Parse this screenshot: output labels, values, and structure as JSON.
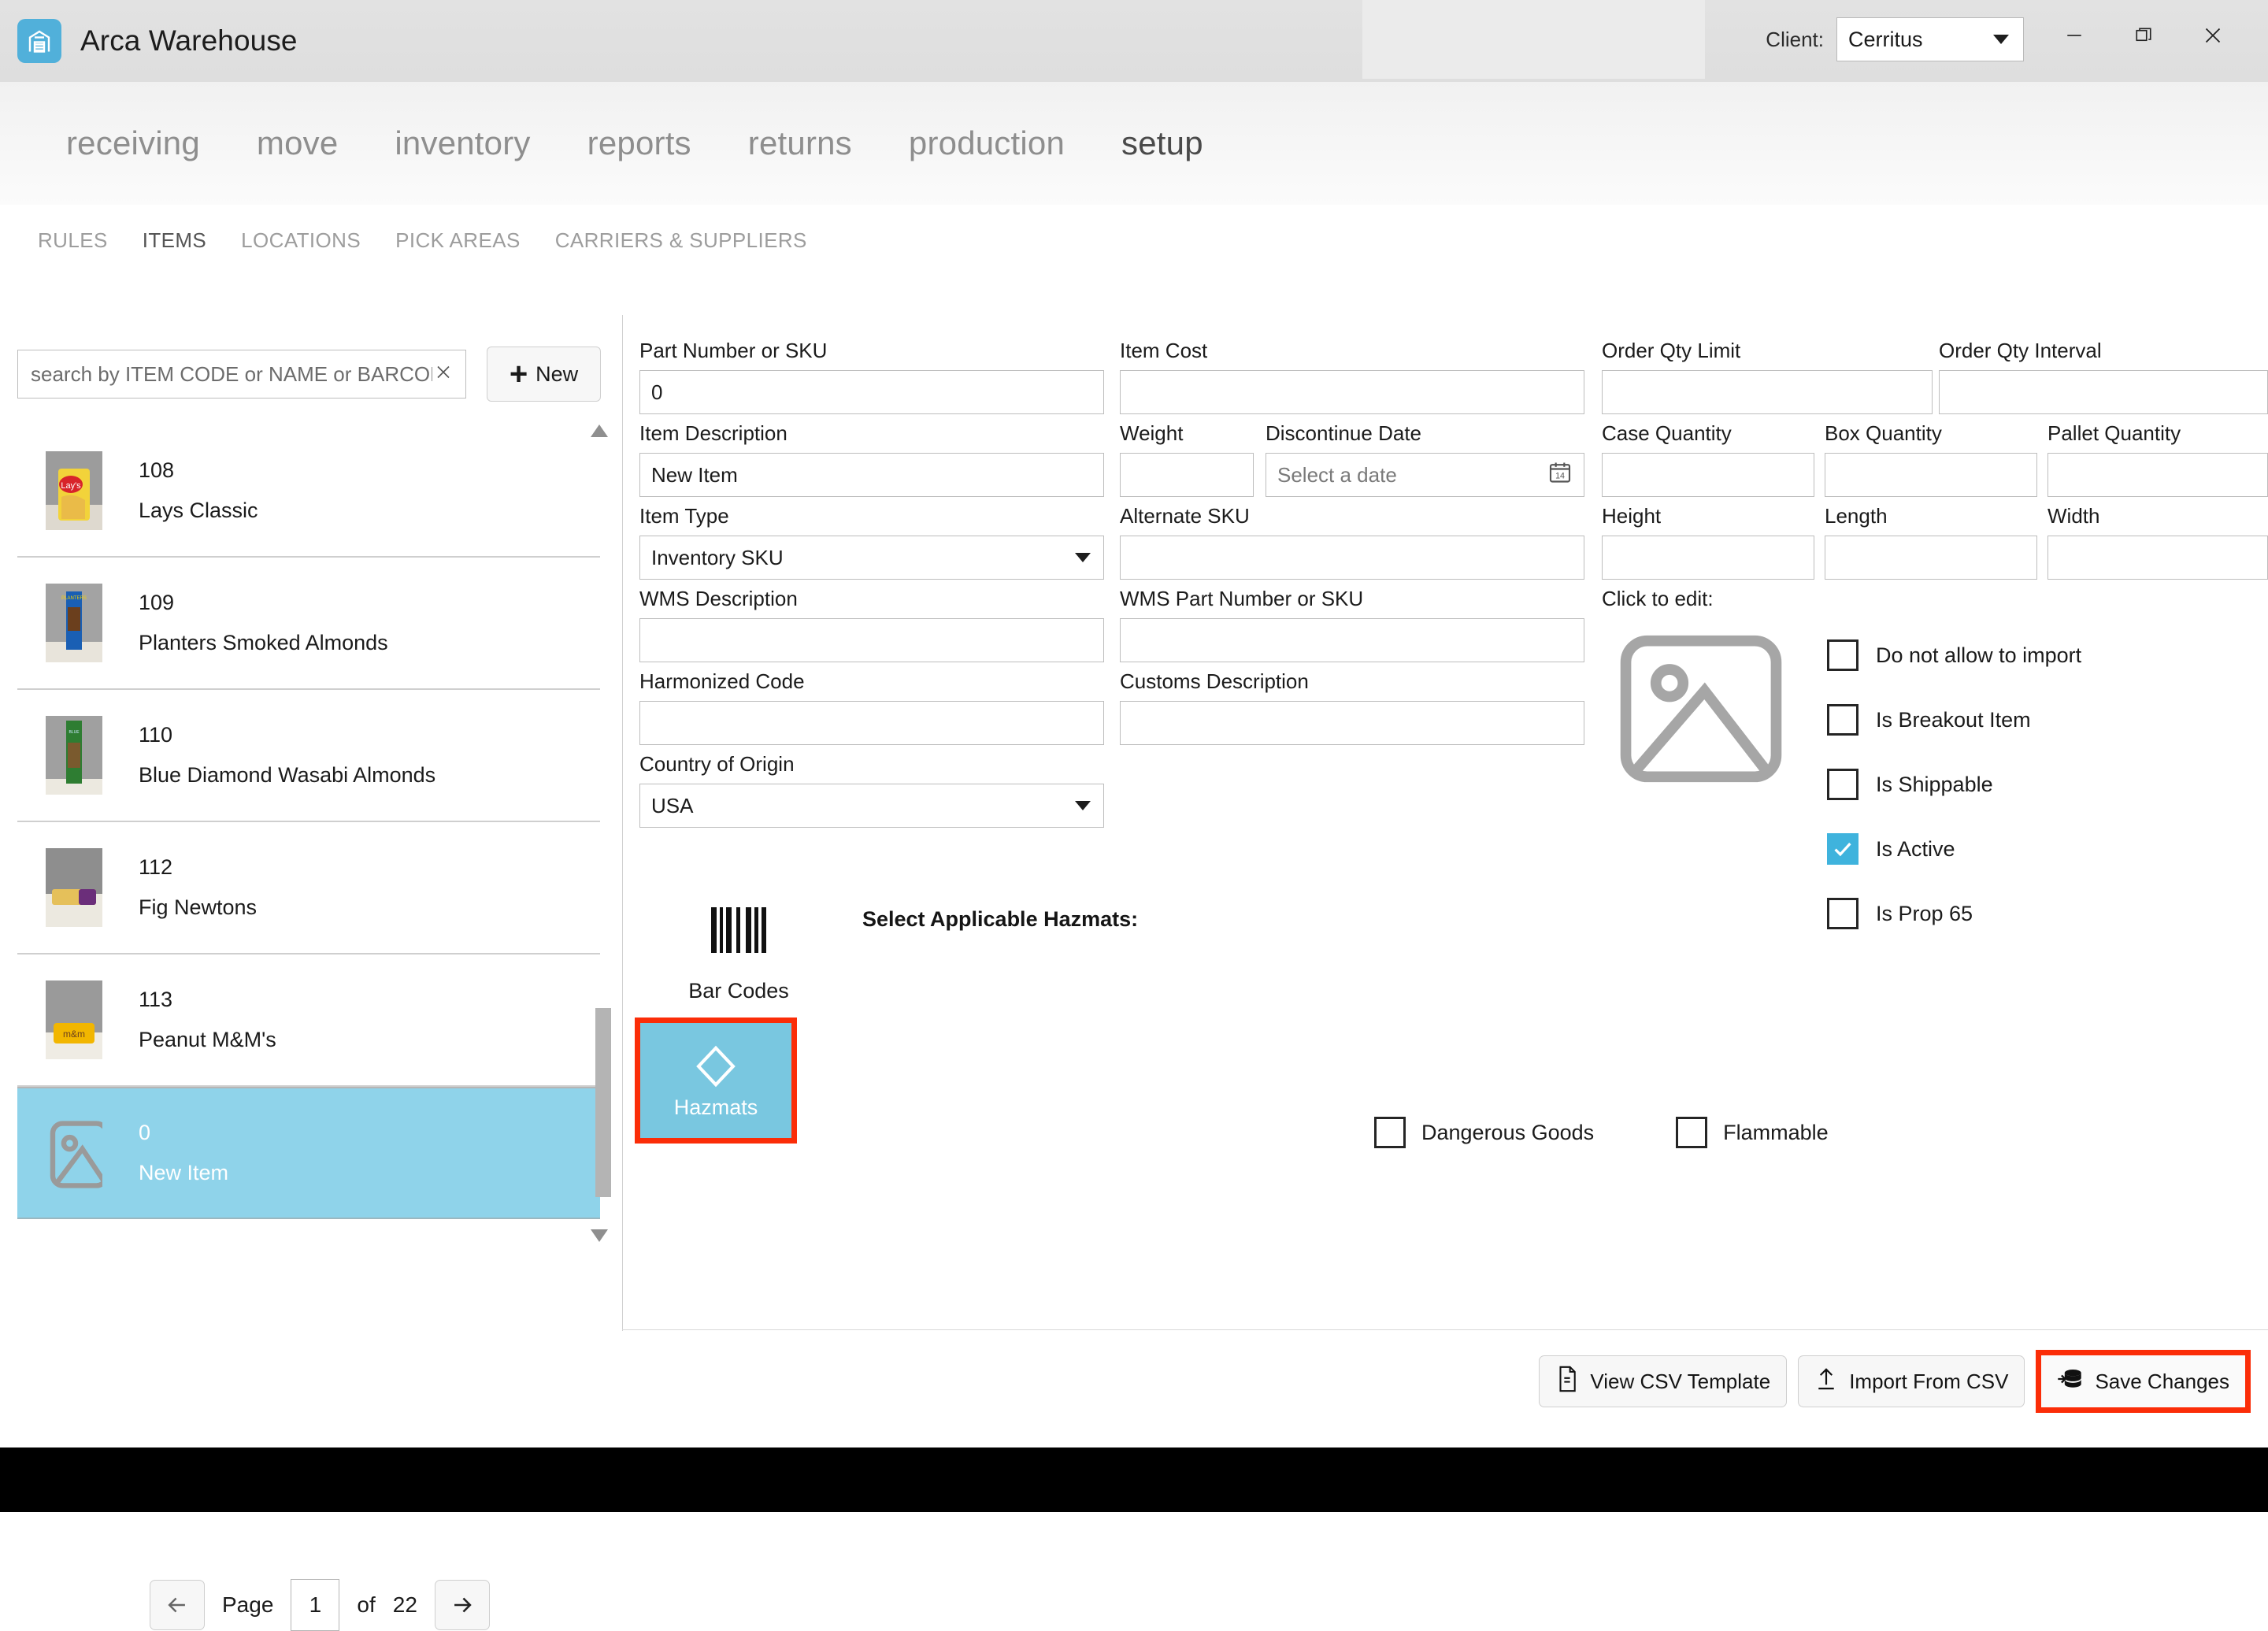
{
  "titlebar": {
    "app_title": "Arca Warehouse",
    "app_icon": "warehouse-icon",
    "client_label": "Client:",
    "client_value": "Cerritus",
    "minimize": "minimize-icon",
    "maximize": "maximize-icon",
    "close": "close-icon"
  },
  "mainnav": {
    "items": [
      {
        "label": "receiving",
        "active": false
      },
      {
        "label": "move",
        "active": false
      },
      {
        "label": "inventory",
        "active": false
      },
      {
        "label": "reports",
        "active": false
      },
      {
        "label": "returns",
        "active": false
      },
      {
        "label": "production",
        "active": false
      },
      {
        "label": "setup",
        "active": true
      }
    ]
  },
  "subtabs": {
    "items": [
      {
        "label": "RULES",
        "active": false
      },
      {
        "label": "ITEMS",
        "active": true
      },
      {
        "label": "LOCATIONS",
        "active": false
      },
      {
        "label": "PICK AREAS",
        "active": false
      },
      {
        "label": "CARRIERS & SUPPLIERS",
        "active": false
      }
    ]
  },
  "search": {
    "placeholder": "search by ITEM CODE or NAME or BARCODE",
    "value": "",
    "clear_icon": "close-icon",
    "new_label": "New",
    "plus": "+"
  },
  "items": [
    {
      "code": "108",
      "name": "Lays Classic",
      "selected": false
    },
    {
      "code": "109",
      "name": "Planters Smoked Almonds",
      "selected": false
    },
    {
      "code": "110",
      "name": "Blue Diamond Wasabi Almonds",
      "selected": false
    },
    {
      "code": "112",
      "name": "Fig Newtons",
      "selected": false
    },
    {
      "code": "113",
      "name": "Peanut M&M's",
      "selected": false
    },
    {
      "code": "0",
      "name": "New Item",
      "selected": true
    }
  ],
  "pager": {
    "prev_icon": "arrow-left-icon",
    "page_label": "Page",
    "page_value": "1",
    "of_label": "of",
    "total_pages": "22",
    "next_icon": "arrow-right-icon"
  },
  "form": {
    "part_number_label": "Part Number or SKU",
    "part_number_value": "0",
    "item_description_label": "Item Description",
    "item_description_value": "New Item",
    "item_type_label": "Item Type",
    "item_type_value": "Inventory SKU",
    "wms_description_label": "WMS Description",
    "wms_description_value": "",
    "harmonized_code_label": "Harmonized Code",
    "harmonized_code_value": "",
    "country_of_origin_label": "Country of Origin",
    "country_of_origin_value": "USA",
    "item_cost_label": "Item Cost",
    "item_cost_value": "",
    "weight_label": "Weight",
    "weight_value": "",
    "discontinue_date_label": "Discontinue Date",
    "discontinue_date_placeholder": "Select a date",
    "calendar_icon": "calendar-icon",
    "calendar_day": "14",
    "alternate_sku_label": "Alternate SKU",
    "alternate_sku_value": "",
    "wms_part_number_label": "WMS Part Number or SKU",
    "wms_part_number_value": "",
    "customs_description_label": "Customs Description",
    "customs_description_value": "",
    "order_qty_limit_label": "Order Qty Limit",
    "order_qty_limit_value": "",
    "order_qty_interval_label": "Order Qty Interval",
    "order_qty_interval_value": "",
    "case_quantity_label": "Case Quantity",
    "case_quantity_value": "",
    "box_quantity_label": "Box Quantity",
    "box_quantity_value": "",
    "pallet_quantity_label": "Pallet Quantity",
    "pallet_quantity_value": "",
    "height_label": "Height",
    "height_value": "",
    "length_label": "Length",
    "length_value": "",
    "width_label": "Width",
    "width_value": "",
    "click_to_edit_label": "Click to edit:",
    "image_placeholder_icon": "image-placeholder-icon"
  },
  "flags": [
    {
      "label": "Do not allow to import",
      "checked": false
    },
    {
      "label": "Is Breakout Item",
      "checked": false
    },
    {
      "label": "Is Shippable",
      "checked": false
    },
    {
      "label": "Is Active",
      "checked": true
    },
    {
      "label": "Is Prop 65",
      "checked": false
    }
  ],
  "hazmat": {
    "barcode_icon": "barcode-icon",
    "barcode_label": "Bar Codes",
    "hazmats_icon": "diamond-icon",
    "hazmats_label": "Hazmats",
    "select_label": "Select Applicable Hazmats:",
    "checks": [
      {
        "label": "Dangerous Goods",
        "checked": false
      },
      {
        "label": "Flammable",
        "checked": false
      }
    ]
  },
  "bottombar": {
    "view_csv_icon": "document-icon",
    "view_csv_label": "View CSV Template",
    "import_csv_icon": "upload-icon",
    "import_csv_label": "Import From CSV",
    "save_icon": "database-save-icon",
    "save_label": "Save Changes"
  },
  "colors": {
    "accent": "#3fb3dd",
    "selected_row": "#8fd3ea",
    "hazmat_button": "#79c7e0",
    "annotation": "#fb2d08"
  }
}
